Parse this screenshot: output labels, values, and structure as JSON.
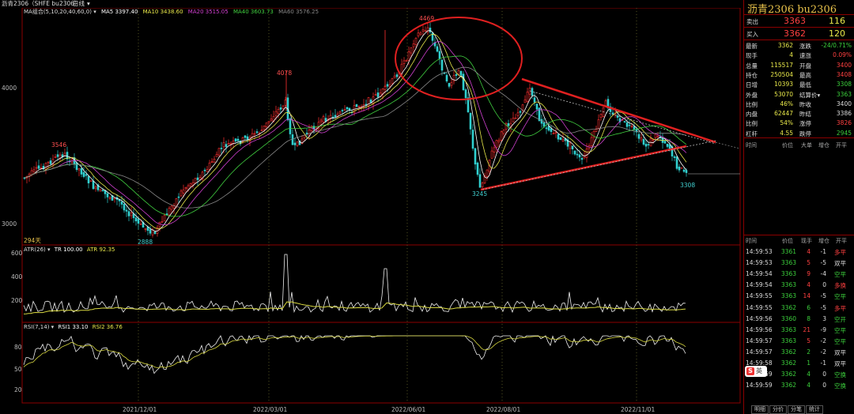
{
  "window": {
    "instrument": "沥青2306（SHFE bu2306）",
    "period": "日线",
    "dropdown": "▾"
  },
  "ma_legend": {
    "group": "MA组合(5,10,20,40,60,0)",
    "ma5": "MA5 3397.40",
    "ma10": "MA10 3438.60",
    "ma20": "MA20 3515.05",
    "ma40": "MA40 3603.73",
    "ma60": "MA60 3576.25",
    "colors": {
      "ma5": "#ffffff",
      "ma10": "#e8e84a",
      "ma20": "#d040d0",
      "ma40": "#40d040",
      "ma60": "#888888"
    }
  },
  "price_axis": {
    "labels": [
      "4000",
      "3000"
    ]
  },
  "price_annotations": {
    "high_peak": "4469",
    "high_mid": "4078",
    "left_high": "3546",
    "low_bottom": "2888",
    "low_mid": "3245",
    "last_low": "3308",
    "days": "294天"
  },
  "atr_legend": {
    "name": "ATR(26)",
    "tr": "TR 100.00",
    "atr": "ATR 92.35",
    "axis": [
      "600",
      "400",
      "200"
    ]
  },
  "rsi_legend": {
    "name": "RSI(7,14)",
    "rsi1": "RSI1 33.10",
    "rsi2": "RSI2 36.76",
    "axis": [
      "80",
      "50",
      "20"
    ]
  },
  "date_axis": [
    "2021/12/01",
    "2022/03/01",
    "2022/06/01",
    "2022/08/01",
    "2022/11/01"
  ],
  "quote": {
    "title": "沥青2306  bu2306",
    "ask": {
      "label": "卖出",
      "price": "3363",
      "vol": "116"
    },
    "bid": {
      "label": "买入",
      "price": "3362",
      "vol": "120"
    },
    "rows": [
      {
        "l1": "最新",
        "v1": "3362",
        "c1": "#e8e84a",
        "l2": "涨跌",
        "v2": "-24/0.71%",
        "c2": "#3cd03c"
      },
      {
        "l1": "现手",
        "v1": "4",
        "c1": "#e8e84a",
        "l2": "速涨",
        "v2": "0.09%",
        "c2": "#ff4040"
      },
      {
        "l1": "总量",
        "v1": "115517",
        "c1": "#e8e84a",
        "l2": "开盘",
        "v2": "3400",
        "c2": "#ff4040"
      },
      {
        "l1": "持仓",
        "v1": "250504",
        "c1": "#e8e84a",
        "l2": "最高",
        "v2": "3408",
        "c2": "#ff4040"
      },
      {
        "l1": "日增",
        "v1": "10393",
        "c1": "#e8e84a",
        "l2": "最低",
        "v2": "3308",
        "c2": "#3cd03c"
      },
      {
        "l1": "外盘",
        "v1": "53070",
        "c1": "#e8e84a",
        "l2": "结算价▾",
        "v2": "3363",
        "c2": "#3cd03c"
      },
      {
        "l1": "比例",
        "v1": "46%",
        "c1": "#e8e84a",
        "l2": "昨收",
        "v2": "3400",
        "c2": "#dddddd"
      },
      {
        "l1": "内盘",
        "v1": "62447",
        "c1": "#e8e84a",
        "l2": "昨结",
        "v2": "3386",
        "c2": "#dddddd"
      },
      {
        "l1": "比例",
        "v1": "54%",
        "c1": "#e8e84a",
        "l2": "涨停",
        "v2": "3826",
        "c2": "#ff4040"
      },
      {
        "l1": "杠杆",
        "v1": "4.55",
        "c1": "#e8e84a",
        "l2": "跌停",
        "v2": "2945",
        "c2": "#3cd03c"
      }
    ],
    "depth_header": [
      "时间",
      "价位",
      "大单",
      "增仓",
      "开平"
    ]
  },
  "ticks": {
    "header": [
      "时间",
      "价位",
      "现手",
      "增仓",
      "开平"
    ],
    "rows": [
      {
        "time": "14:59:53",
        "price": "3361",
        "pc": "#3cd03c",
        "vol": "4",
        "vc": "#ff4040",
        "inc": "-1",
        "type": "多平"
      },
      {
        "time": "14:59:53",
        "price": "3363",
        "pc": "#3cd03c",
        "vol": "5",
        "vc": "#ff4040",
        "inc": "-5",
        "type": "双平"
      },
      {
        "time": "14:59:54",
        "price": "3363",
        "pc": "#3cd03c",
        "vol": "9",
        "vc": "#ff4040",
        "inc": "-4",
        "type": "空平"
      },
      {
        "time": "14:59:54",
        "price": "3363",
        "pc": "#3cd03c",
        "vol": "4",
        "vc": "#ff4040",
        "inc": "0",
        "type": "多换"
      },
      {
        "time": "14:59:55",
        "price": "3363",
        "pc": "#3cd03c",
        "vol": "14",
        "vc": "#ff4040",
        "inc": "-5",
        "type": "空平"
      },
      {
        "time": "14:59:55",
        "price": "3362",
        "pc": "#3cd03c",
        "vol": "6",
        "vc": "#3cd03c",
        "inc": "-5",
        "type": "多平"
      },
      {
        "time": "14:59:56",
        "price": "3360",
        "pc": "#3cd03c",
        "vol": "8",
        "vc": "#3cd03c",
        "inc": "3",
        "type": "空开"
      },
      {
        "time": "14:59:56",
        "price": "3363",
        "pc": "#3cd03c",
        "vol": "21",
        "vc": "#ff4040",
        "inc": "-9",
        "type": "空平"
      },
      {
        "time": "14:59:57",
        "price": "3363",
        "pc": "#3cd03c",
        "vol": "5",
        "vc": "#ff4040",
        "inc": "-2",
        "type": "空平"
      },
      {
        "time": "14:59:57",
        "price": "3362",
        "pc": "#3cd03c",
        "vol": "2",
        "vc": "#3cd03c",
        "inc": "-2",
        "type": "双平"
      },
      {
        "time": "14:59:58",
        "price": "3362",
        "pc": "#3cd03c",
        "vol": "1",
        "vc": "#3cd03c",
        "inc": "-1",
        "type": "双平"
      },
      {
        "time": "14:59:59",
        "price": "3362",
        "pc": "#3cd03c",
        "vol": "4",
        "vc": "#3cd03c",
        "inc": "0",
        "type": "空换"
      },
      {
        "time": "14:59:59",
        "price": "3362",
        "pc": "#3cd03c",
        "vol": "4",
        "vc": "#3cd03c",
        "inc": "0",
        "type": "空换"
      }
    ]
  },
  "bottom_tabs": [
    "明细",
    "分价",
    "分笔",
    "统计"
  ],
  "ime": {
    "icon": "S",
    "text": "英 ·, ☺ ⚲ ⌨ ▣ ⊞ ✽"
  }
}
